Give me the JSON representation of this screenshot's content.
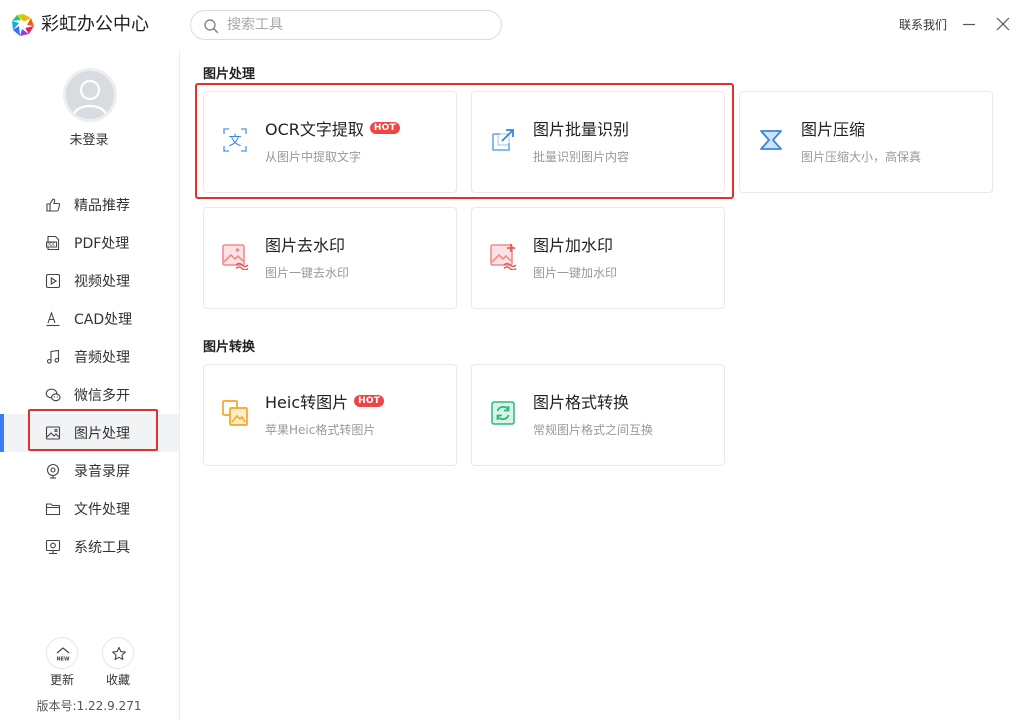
{
  "app": {
    "title": "彩虹办公中心"
  },
  "search": {
    "placeholder": "搜索工具"
  },
  "header": {
    "contact": "联系我们"
  },
  "user": {
    "status": "未登录"
  },
  "sidebar": {
    "items": [
      {
        "label": "精品推荐",
        "icon": "thumbs-up-icon"
      },
      {
        "label": "PDF处理",
        "icon": "pdf-icon"
      },
      {
        "label": "视频处理",
        "icon": "video-icon"
      },
      {
        "label": "CAD处理",
        "icon": "cad-icon"
      },
      {
        "label": "音频处理",
        "icon": "music-icon"
      },
      {
        "label": "微信多开",
        "icon": "wechat-icon"
      },
      {
        "label": "图片处理",
        "icon": "image-icon",
        "active": true
      },
      {
        "label": "录音录屏",
        "icon": "record-icon"
      },
      {
        "label": "文件处理",
        "icon": "folder-icon"
      },
      {
        "label": "系统工具",
        "icon": "system-icon"
      }
    ],
    "update_label": "更新",
    "update_badge": "NEW",
    "favorite_label": "收藏",
    "version": "版本号:1.22.9.271"
  },
  "sections": [
    {
      "title": "图片处理",
      "cards": [
        {
          "title": "OCR文字提取",
          "desc": "从图片中提取文字",
          "hot": "HOT",
          "icon": "ocr-text-icon"
        },
        {
          "title": "图片批量识别",
          "desc": "批量识别图片内容",
          "icon": "batch-recognize-icon"
        },
        {
          "title": "图片压缩",
          "desc": "图片压缩大小，高保真",
          "icon": "compress-icon"
        },
        {
          "title": "图片去水印",
          "desc": "图片一键去水印",
          "icon": "remove-watermark-icon"
        },
        {
          "title": "图片加水印",
          "desc": "图片一键加水印",
          "icon": "add-watermark-icon"
        }
      ]
    },
    {
      "title": "图片转换",
      "cards": [
        {
          "title": "Heic转图片",
          "desc": "苹果Heic格式转图片",
          "hot": "HOT",
          "icon": "heic-convert-icon"
        },
        {
          "title": "图片格式转换",
          "desc": "常规图片格式之间互换",
          "icon": "format-convert-icon"
        }
      ]
    }
  ],
  "colors": {
    "accent": "#3b7cf5",
    "hot": "#f04545",
    "highlight": "#e03030"
  }
}
